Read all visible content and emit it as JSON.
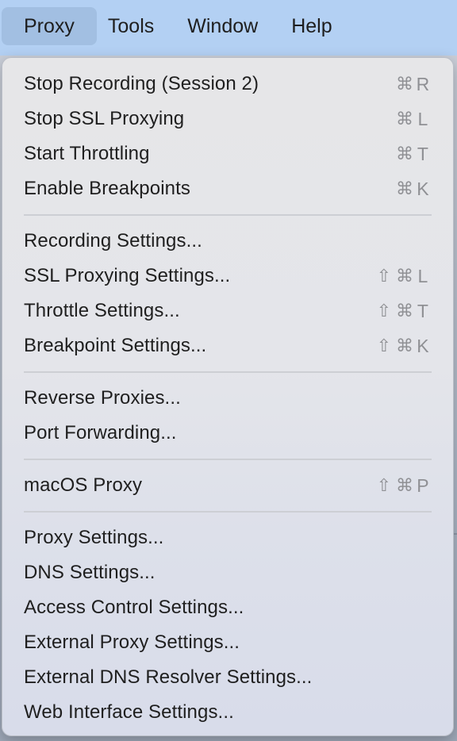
{
  "menubar": {
    "items": [
      {
        "label": "Proxy"
      },
      {
        "label": "Tools"
      },
      {
        "label": "Window"
      },
      {
        "label": "Help"
      }
    ]
  },
  "menu": {
    "groups": [
      [
        {
          "label": "Stop Recording (Session 2)",
          "shortcut": {
            "shift": false,
            "cmd": "⌘",
            "key": "R"
          }
        },
        {
          "label": "Stop SSL Proxying",
          "shortcut": {
            "shift": false,
            "cmd": "⌘",
            "key": "L"
          }
        },
        {
          "label": "Start Throttling",
          "shortcut": {
            "shift": false,
            "cmd": "⌘",
            "key": "T"
          }
        },
        {
          "label": "Enable Breakpoints",
          "shortcut": {
            "shift": false,
            "cmd": "⌘",
            "key": "K"
          }
        }
      ],
      [
        {
          "label": "Recording Settings...",
          "shortcut": null
        },
        {
          "label": "SSL Proxying Settings...",
          "shortcut": {
            "shift": true,
            "cmd": "⌘",
            "key": "L"
          }
        },
        {
          "label": "Throttle Settings...",
          "shortcut": {
            "shift": true,
            "cmd": "⌘",
            "key": "T"
          }
        },
        {
          "label": "Breakpoint Settings...",
          "shortcut": {
            "shift": true,
            "cmd": "⌘",
            "key": "K"
          }
        }
      ],
      [
        {
          "label": "Reverse Proxies...",
          "shortcut": null
        },
        {
          "label": "Port Forwarding...",
          "shortcut": null
        }
      ],
      [
        {
          "label": "macOS Proxy",
          "shortcut": {
            "shift": true,
            "cmd": "⌘",
            "key": "P"
          }
        }
      ],
      [
        {
          "label": "Proxy Settings...",
          "shortcut": null
        },
        {
          "label": "DNS Settings...",
          "shortcut": null
        },
        {
          "label": "Access Control Settings...",
          "shortcut": null
        },
        {
          "label": "External Proxy Settings...",
          "shortcut": null
        },
        {
          "label": "External DNS Resolver Settings...",
          "shortcut": null
        },
        {
          "label": "Web Interface Settings...",
          "shortcut": null
        }
      ]
    ]
  },
  "icons": {
    "shift": "⇧"
  },
  "colors": {
    "menubar": "#b3d0f3",
    "menubar_active": "#a2bfe2",
    "menu_text": "#1f1f1f",
    "shortcut_text": "#8f9094"
  }
}
